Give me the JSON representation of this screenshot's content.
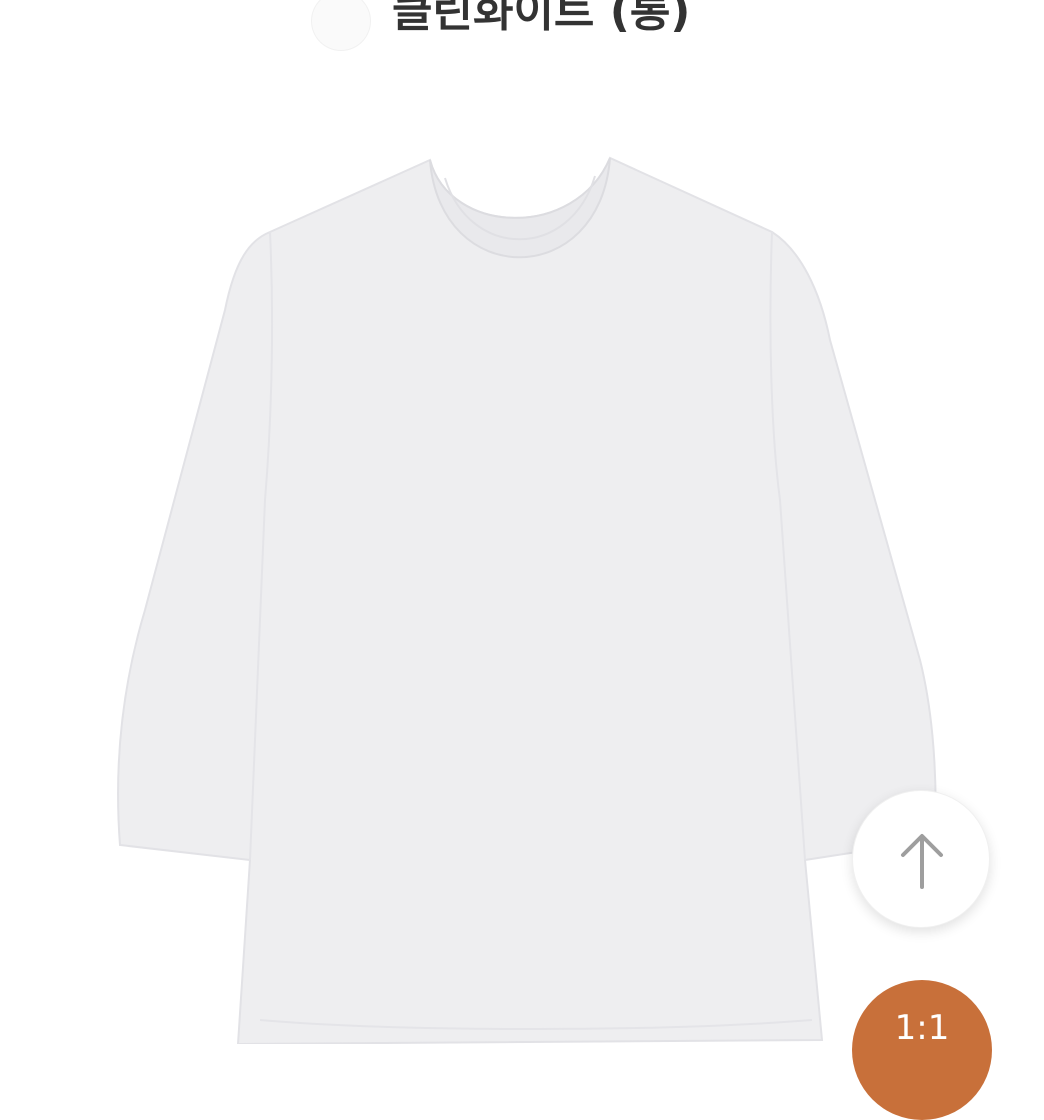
{
  "option": {
    "color_name": "클린화이트 (롱)",
    "swatch_color": "#fafafa"
  },
  "product_image": {
    "icon": "long-sleeve-tshirt-icon",
    "color": "#eeeef0"
  },
  "scroll_top_button": {
    "icon": "arrow-up-icon"
  },
  "chat_button": {
    "label": "1:1",
    "color": "#c8703a"
  }
}
